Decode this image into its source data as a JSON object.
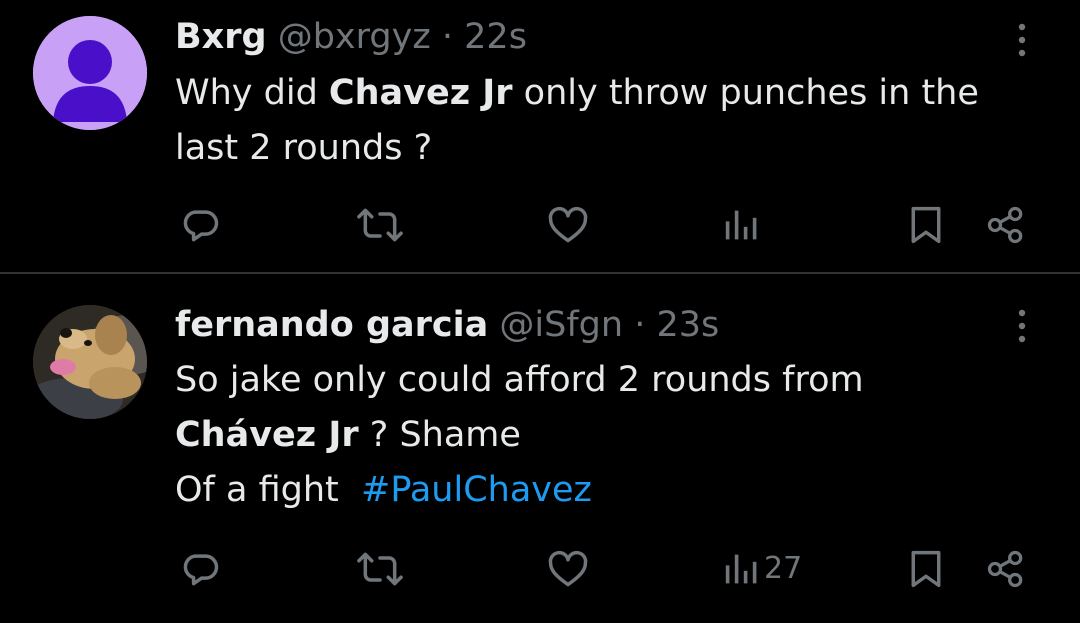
{
  "tweets": [
    {
      "author": {
        "name": "Bxrg",
        "handle": "@bxrgyz",
        "avatar": "default-avatar-icon"
      },
      "separator": "·",
      "time": "22s",
      "text": {
        "line1_pre": "Why did ",
        "line1_bold": "Chavez Jr",
        "line1_post": " only throw punches in the",
        "line2": "last 2 rounds ?"
      },
      "actions": {
        "reply_icon": "reply-icon",
        "retweet_icon": "retweet-icon",
        "like_icon": "like-icon",
        "views_icon": "views-icon",
        "views_count": "",
        "bookmark_icon": "bookmark-icon",
        "share_icon": "share-icon"
      }
    },
    {
      "author": {
        "name": "fernando garcia",
        "handle": "@iSfgn",
        "avatar": "dog-photo-avatar"
      },
      "separator": "·",
      "time": "23s",
      "text": {
        "line1": "So jake only could afford 2 rounds from",
        "line2_bold": "Chávez Jr",
        "line2_post": " ? Shame",
        "line3_pre": "Of a fight  ",
        "hashtag": "#PaulChavez"
      },
      "actions": {
        "reply_icon": "reply-icon",
        "retweet_icon": "retweet-icon",
        "like_icon": "like-icon",
        "views_icon": "views-icon",
        "views_count": "27",
        "bookmark_icon": "bookmark-icon",
        "share_icon": "share-icon"
      }
    }
  ],
  "colors": {
    "background": "#000000",
    "text_primary": "#e7e9ea",
    "text_secondary": "#71767b",
    "link": "#1d9bf0",
    "divider": "#2f3336",
    "default_avatar_bg": "#c8a0f5",
    "default_avatar_fg": "#4a10c9"
  }
}
